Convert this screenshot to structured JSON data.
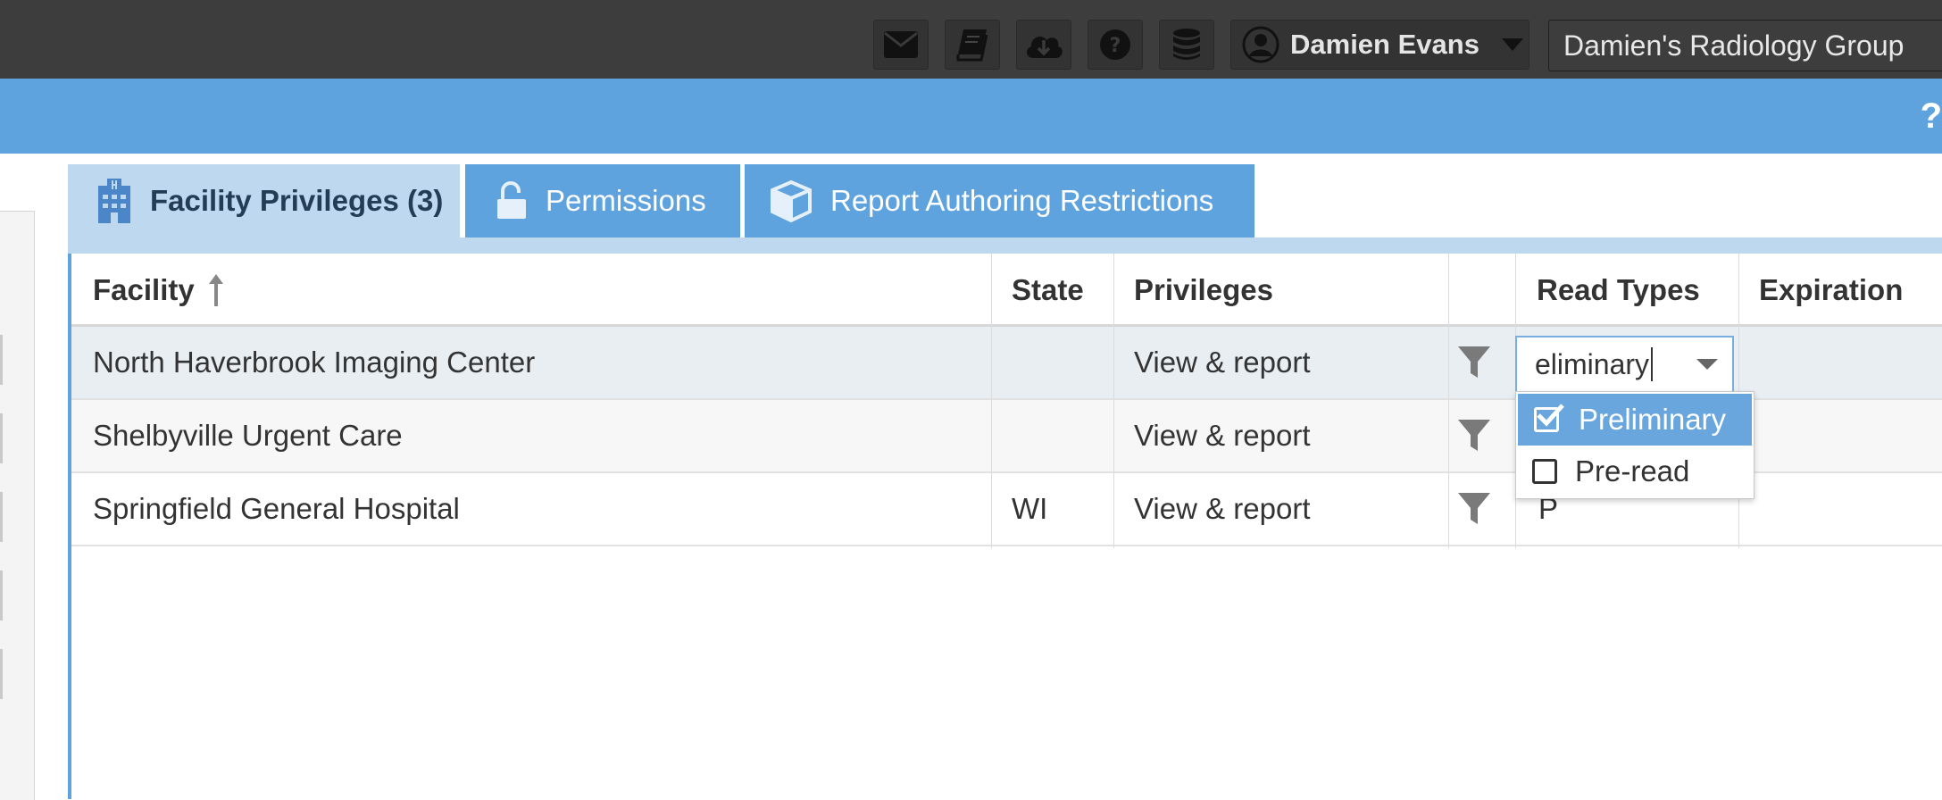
{
  "header": {
    "icons": [
      "envelope-icon",
      "book-icon",
      "cloud-download-icon",
      "help-circle-icon",
      "database-icon"
    ],
    "user_name": "Damien Evans",
    "organization": "Damien's Radiology Group"
  },
  "banner": {
    "help_glyph": "?"
  },
  "tabs": [
    {
      "label": "Facility Privileges (3)",
      "icon": "hospital-building-icon",
      "active": true
    },
    {
      "label": "Permissions",
      "icon": "unlock-icon",
      "active": false
    },
    {
      "label": "Report Authoring Restrictions",
      "icon": "cube-icon",
      "active": false
    }
  ],
  "table": {
    "columns": {
      "facility": "Facility",
      "state": "State",
      "privileges": "Privileges",
      "read_types": "Read Types",
      "expiration": "Expiration"
    },
    "sort_icon": "sort-ascending-icon",
    "rows": [
      {
        "facility": "North Haverbrook Imaging Center",
        "state": "",
        "privileges": "View & report",
        "read_types": "",
        "expiration": ""
      },
      {
        "facility": "Shelbyville Urgent Care",
        "state": "",
        "privileges": "View & report",
        "read_types": "",
        "expiration": ""
      },
      {
        "facility": "Springfield General Hospital",
        "state": "WI",
        "privileges": "View & report",
        "read_types": "P",
        "expiration": ""
      }
    ]
  },
  "read_type_editor": {
    "input_value": "eliminary",
    "options": [
      {
        "label": "Preliminary",
        "checked": true
      },
      {
        "label": "Pre-read",
        "checked": false
      }
    ]
  },
  "colors": {
    "topbar": "#3d3d3d",
    "banner": "#5ea3de",
    "active_tab": "#bed8ef",
    "selected_option": "#6aa6de"
  }
}
